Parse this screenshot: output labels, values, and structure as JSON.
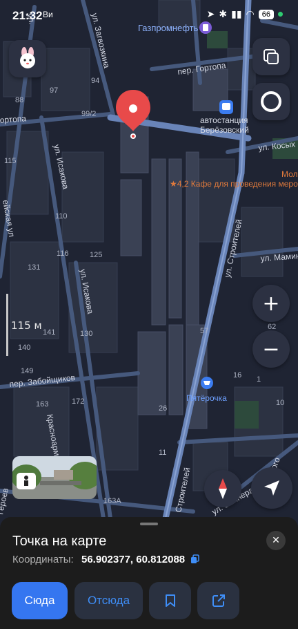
{
  "status_bar": {
    "time": "21:32",
    "carrier": "Ви",
    "battery": "66"
  },
  "map": {
    "streets": {
      "zagvozkina": "ул. Загвозкина",
      "gortopa_right": "пер. Гортопа",
      "gortopa_left": "ортопа",
      "isakova_top": "ул. Исакова",
      "isakova_mid": "ул. Исакова",
      "koshikh": "ул. Косых",
      "stroiteley_right": "ул. Строителей",
      "stroiteley_bottom": "Строителей",
      "maminа": "ул. Мамин",
      "zaboyshchikov": "пер. Забойщиков",
      "krasnoarm": "Красноармей",
      "heroes": "Героев",
      "vaynera": "ул. Вайнера",
      "diagonal_left": "ейская ул",
      "top_left": "ул.",
      "right_edge": "ого"
    },
    "house_numbers": [
      "97",
      "88",
      "99/2",
      "94",
      "115",
      "110",
      "116",
      "131",
      "125",
      "141",
      "130",
      "140",
      "149",
      "163",
      "172",
      "26",
      "11",
      "16",
      "1",
      "10",
      "2",
      "163А",
      "57",
      "62"
    ],
    "pois": {
      "gas_station": "Газпромнефть",
      "bus_station_line1": "автостанция",
      "bus_station_line2": "Берёзовский",
      "cafe": "★4,2 Кафе для проведения меро",
      "cafe_top": "Мол",
      "shop": "Пятёрочка"
    },
    "scale_label": "115 м",
    "colors": {
      "background": "#1f2433",
      "road": "#4a5f86",
      "road_main": "#6a85b8",
      "building": "#343a4a",
      "pin": "#e84a4a",
      "poi_orange": "#e07a3c",
      "poi_blue": "#6ea0ff"
    }
  },
  "controls": {
    "zoom_in": "+",
    "zoom_out": "−",
    "avatar_icon": "bunny-avatar-icon",
    "layers_icon": "layers-icon",
    "alice_icon": "alice-ring-icon",
    "compass_icon": "compass-icon",
    "location_icon": "navigation-arrow-icon"
  },
  "sheet": {
    "title": "Точка на карте",
    "coord_label": "Координаты:",
    "coord_value": "56.902377, 60.812088",
    "close": "✕",
    "actions": {
      "here": "Сюда",
      "from": "Отсюда"
    }
  }
}
